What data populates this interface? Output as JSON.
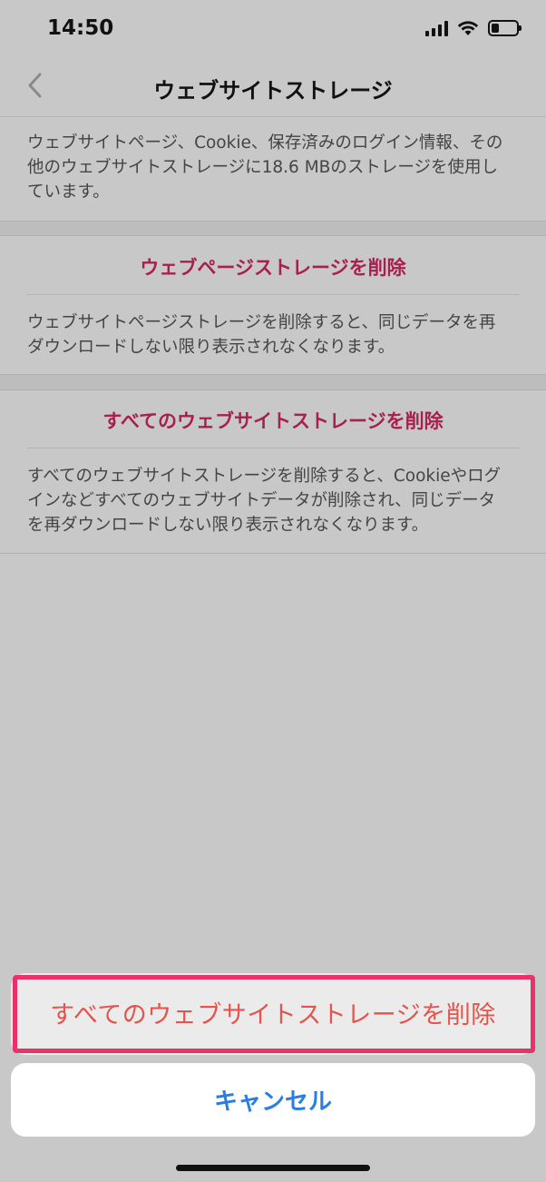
{
  "status": {
    "time": "14:50"
  },
  "nav": {
    "title": "ウェブサイトストレージ"
  },
  "summary": {
    "line1": "ウェブサイトページ、Cookie、保存済みのログイン情報、その",
    "line2": "他のウェブサイトストレージに18.6 MBのストレージを使用し",
    "line3": "ています。"
  },
  "section1": {
    "action": "ウェブページストレージを削除",
    "line1": "ウェブサイトページストレージを削除すると、同じデータを再",
    "line2": "ダウンロードしない限り表示されなくなります。"
  },
  "section2": {
    "action": "すべてのウェブサイトストレージを削除",
    "line1": "すべてのウェブサイトストレージを削除すると、Cookieやログ",
    "line2": "インなどすべてのウェブサイトデータが削除され、同じデータ",
    "line3": "を再ダウンロードしない限り表示されなくなります。"
  },
  "action_sheet": {
    "destructive_label": "すべてのウェブサイトストレージを削除",
    "cancel_label": "キャンセル"
  },
  "colors": {
    "accent_link": "#a8204f",
    "destructive": "#e5534a",
    "cancel": "#2a7de1",
    "highlight": "#e8336a"
  },
  "icons": {
    "back": "chevron-left-icon",
    "signal": "signal-icon",
    "wifi": "wifi-icon",
    "battery": "battery-icon"
  }
}
